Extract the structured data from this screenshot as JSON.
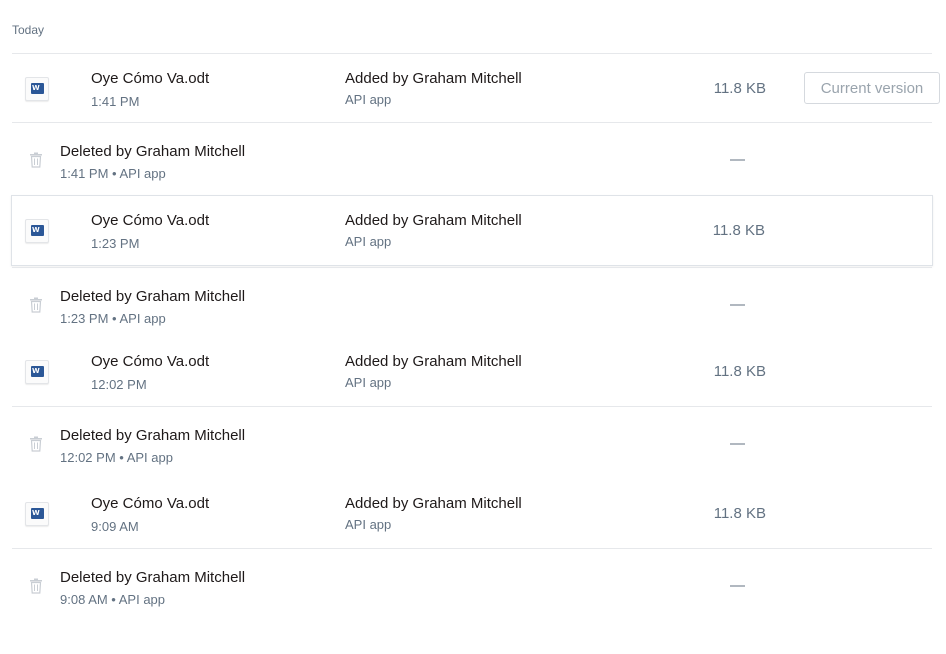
{
  "section": {
    "label": "Today"
  },
  "rows": [
    {
      "type": "file",
      "name": "Oye Cómo Va.odt",
      "time": "1:41 PM",
      "added_by": "Added by Graham Mitchell",
      "app": "API app",
      "size": "11.8 KB",
      "current_version_label": "Current version"
    },
    {
      "type": "deleted",
      "title": "Deleted by Graham Mitchell",
      "meta": "1:41 PM • API app",
      "size": "—"
    },
    {
      "type": "file",
      "name": "Oye Cómo Va.odt",
      "time": "1:23 PM",
      "added_by": "Added by Graham Mitchell",
      "app": "API app",
      "size": "11.8 KB"
    },
    {
      "type": "deleted",
      "title": "Deleted by Graham Mitchell",
      "meta": "1:23 PM • API app",
      "size": "—"
    },
    {
      "type": "file",
      "name": "Oye Cómo Va.odt",
      "time": "12:02 PM",
      "added_by": "Added by Graham Mitchell",
      "app": "API app",
      "size": "11.8 KB"
    },
    {
      "type": "deleted",
      "title": "Deleted by Graham Mitchell",
      "meta": "12:02 PM • API app",
      "size": "—"
    },
    {
      "type": "file",
      "name": "Oye Cómo Va.odt",
      "time": "9:09 AM",
      "added_by": "Added by Graham Mitchell",
      "app": "API app",
      "size": "11.8 KB"
    },
    {
      "type": "deleted",
      "title": "Deleted by Graham Mitchell",
      "meta": "9:08 AM • API app",
      "size": "—"
    }
  ],
  "icons": {
    "file": "word-document-icon",
    "deleted": "trash-icon"
  },
  "colors": {
    "text": "#1e1919",
    "muted": "#637282",
    "divider": "#e6e8eb",
    "doc_blue": "#2b5797"
  }
}
